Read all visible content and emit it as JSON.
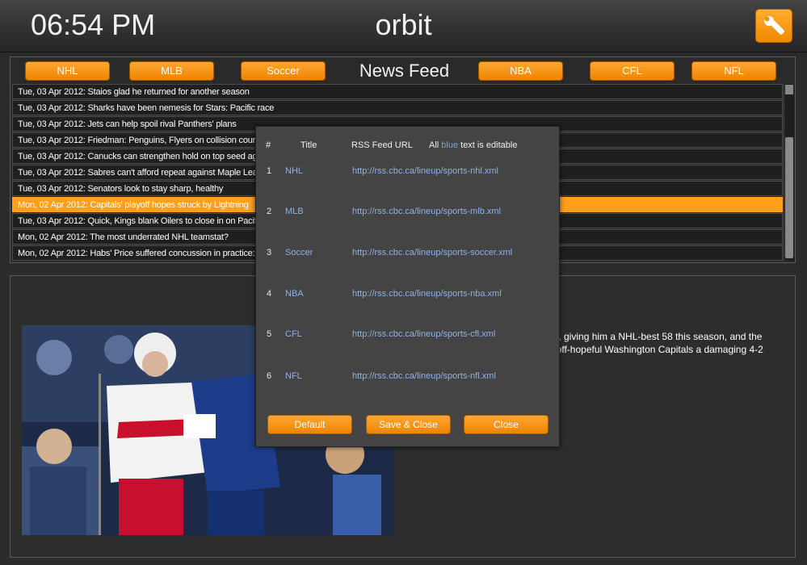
{
  "header": {
    "time": "06:54 PM",
    "app_title": "orbit",
    "settings_icon": "wrench-icon"
  },
  "feed": {
    "title": "News Feed",
    "categories": [
      "NHL",
      "MLB",
      "Soccer",
      "NBA",
      "CFL",
      "NFL"
    ],
    "items": [
      "Tue, 03 Apr 2012: Staios glad he returned for another season",
      "Tue, 03 Apr 2012: Sharks have been nemesis for Stars: Pacific race",
      "Tue, 03 Apr 2012: Jets can help spoil rival Panthers' plans",
      "Tue, 03 Apr 2012: Friedman: Penguins, Flyers on collision course",
      "Tue, 03 Apr 2012: Canucks can strengthen hold on top seed agai",
      "Tue, 03 Apr 2012: Sabres can't afford repeat against Maple Leafs",
      "Tue, 03 Apr 2012: Senators look to stay sharp, healthy",
      "Mon, 02 Apr 2012: Capitals' playoff hopes struck by Lightning",
      "Tue, 03 Apr 2012: Quick, Kings blank Oilers to close in on Pacific",
      "Mon, 02 Apr 2012: The most underrated NHL teamstat?",
      "Mon, 02 Apr 2012: Habs' Price suffered concussion in practice: re"
    ],
    "selected_index": 7
  },
  "detail": {
    "text_line1": "als, giving him a NHL-best 58 this season, and the",
    "text_line2": "ayoff-hopeful Washington Capitals a damaging 4-2"
  },
  "modal": {
    "headers": {
      "num": "#",
      "title": "Title",
      "url": "RSS Feed URL",
      "note_prefix": "All ",
      "note_blue": "blue",
      "note_suffix": " text is editable"
    },
    "rows": [
      {
        "num": "1",
        "title": "NHL",
        "url": "http://rss.cbc.ca/lineup/sports-nhl.xml"
      },
      {
        "num": "2",
        "title": "MLB",
        "url": "http://rss.cbc.ca/lineup/sports-mlb.xml"
      },
      {
        "num": "3",
        "title": "Soccer",
        "url": "http://rss.cbc.ca/lineup/sports-soccer.xml"
      },
      {
        "num": "4",
        "title": "NBA",
        "url": "http://rss.cbc.ca/lineup/sports-nba.xml"
      },
      {
        "num": "5",
        "title": "CFL",
        "url": "http://rss.cbc.ca/lineup/sports-cfl.xml"
      },
      {
        "num": "6",
        "title": "NFL",
        "url": "http://rss.cbc.ca/lineup/sports-nfl.xml"
      }
    ],
    "buttons": {
      "default": "Default",
      "save_close": "Save & Close",
      "close": "Close"
    }
  },
  "colors": {
    "accent": "#f39200",
    "selected_row": "#ff9f1a",
    "editable_text": "#8fb0e8"
  }
}
